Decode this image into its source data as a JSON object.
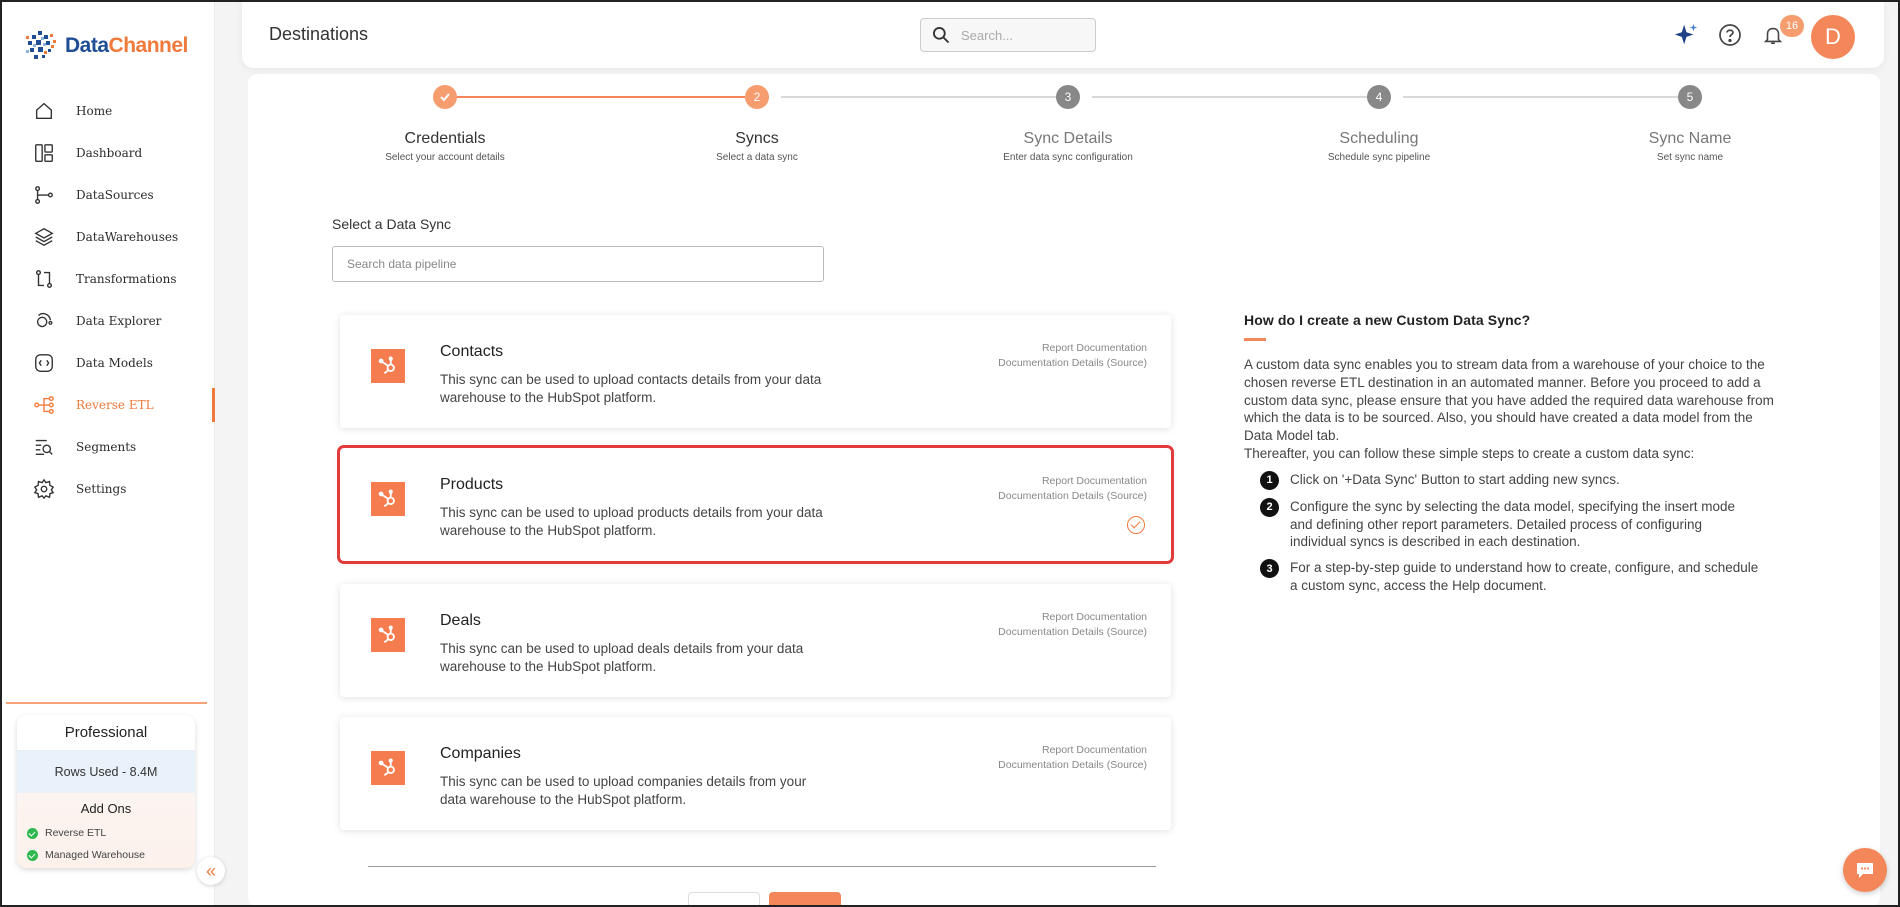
{
  "brand": {
    "name_part1": "Data",
    "name_part2": "Channel",
    "accent": "#f07a3c",
    "blue": "#1f4e96"
  },
  "header": {
    "title": "Destinations",
    "search_placeholder": "Search...",
    "notification_count": "16",
    "avatar_initial": "D"
  },
  "sidebar": {
    "items": [
      {
        "label": "Home",
        "icon": "home-icon"
      },
      {
        "label": "Dashboard",
        "icon": "dashboard-icon"
      },
      {
        "label": "DataSources",
        "icon": "datasources-icon"
      },
      {
        "label": "DataWarehouses",
        "icon": "layers-icon"
      },
      {
        "label": "Transformations",
        "icon": "transform-icon"
      },
      {
        "label": "Data Explorer",
        "icon": "explorer-icon"
      },
      {
        "label": "Data Models",
        "icon": "models-icon"
      },
      {
        "label": "Reverse ETL",
        "icon": "reverse-etl-icon",
        "active": true
      },
      {
        "label": "Segments",
        "icon": "segments-icon"
      },
      {
        "label": "Settings",
        "icon": "gear-icon"
      }
    ],
    "plan": {
      "title": "Professional",
      "rows_used": "Rows Used - 8.4M",
      "addons_title": "Add Ons",
      "addons": [
        "Reverse ETL",
        "Managed Warehouse"
      ]
    }
  },
  "stepper": {
    "steps": [
      {
        "num": "1",
        "title": "Credentials",
        "sub": "Select your account details",
        "state": "done"
      },
      {
        "num": "2",
        "title": "Syncs",
        "sub": "Select a data sync",
        "state": "current"
      },
      {
        "num": "3",
        "title": "Sync Details",
        "sub": "Enter data sync configuration",
        "state": "todo"
      },
      {
        "num": "4",
        "title": "Scheduling",
        "sub": "Schedule sync pipeline",
        "state": "todo"
      },
      {
        "num": "5",
        "title": "Sync Name",
        "sub": "Set sync name",
        "state": "todo"
      }
    ]
  },
  "sync_select": {
    "label": "Select a Data Sync",
    "search_placeholder": "Search data pipeline",
    "link_report": "Report Documentation",
    "link_details": "Documentation Details (Source)",
    "cards": [
      {
        "title": "Contacts",
        "desc": "This sync can be used to upload contacts details from your data warehouse to the HubSpot platform.",
        "selected": false
      },
      {
        "title": "Products",
        "desc": "This sync can be used to upload products details from your data warehouse to the HubSpot platform.",
        "selected": true
      },
      {
        "title": "Deals",
        "desc": "This sync can be used to upload deals details from your data warehouse to the HubSpot platform.",
        "selected": false
      },
      {
        "title": "Companies",
        "desc": "This sync can be used to upload companies details from your data warehouse to the HubSpot platform.",
        "selected": false
      }
    ]
  },
  "help": {
    "title": "How do I create a new Custom Data Sync?",
    "para1": "A custom data sync enables you to stream data from a warehouse of your choice to the chosen reverse ETL destination in an automated manner. Before you proceed to add a custom data sync, please ensure that you have added the required data warehouse from which the data is to be sourced. Also, you should have created a data model from the Data Model tab.",
    "para2": "Thereafter, you can follow these simple steps to create a custom data sync:",
    "steps": [
      {
        "num": "1",
        "text": "Click on '+Data Sync' Button to start adding new syncs."
      },
      {
        "num": "2",
        "text": "Configure the sync by selecting the data model, specifying the insert mode and defining other report parameters. Detailed process of configuring individual syncs is described in each destination."
      },
      {
        "num": "3",
        "text": "For a step-by-step guide to understand how to create, configure, and schedule a custom sync, access the Help document."
      }
    ]
  }
}
